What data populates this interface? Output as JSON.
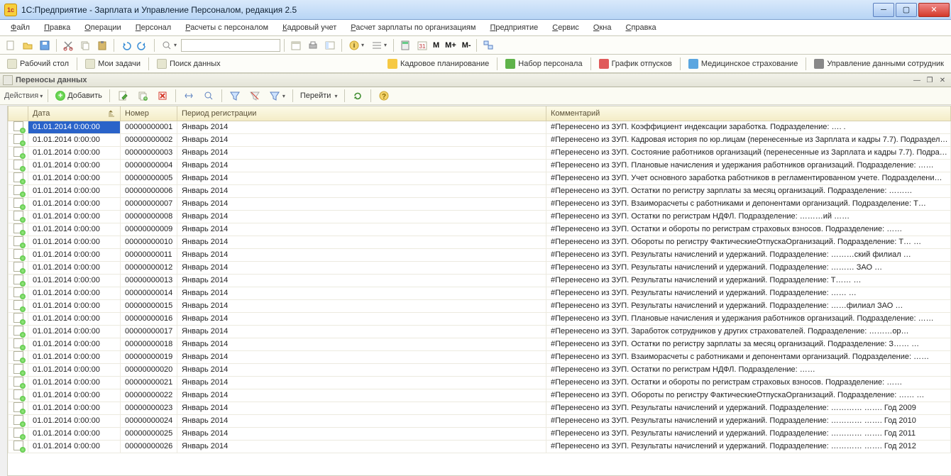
{
  "title": "1С:Предприятие - Зарплата и Управление Персоналом, редакция 2.5",
  "menus": [
    "Файл",
    "Правка",
    "Операции",
    "Персонал",
    "Расчеты с персоналом",
    "Кадровый учет",
    "Расчет зарплаты по организациям",
    "Предприятие",
    "Сервис",
    "Окна",
    "Справка"
  ],
  "toolbar_mm": {
    "m": "M",
    "m_plus": "M+",
    "m_minus": "M-"
  },
  "row2_left": [
    {
      "label": "Рабочий стол"
    },
    {
      "label": "Мои задачи"
    },
    {
      "label": "Поиск данных"
    }
  ],
  "row2_right": [
    {
      "label": "Кадровое планирование",
      "chip": "#f6c944"
    },
    {
      "label": "Набор персонала",
      "chip": "#5fb34a"
    },
    {
      "label": "График отпусков",
      "chip": "#e05a5a"
    },
    {
      "label": "Медицинское страхование",
      "chip": "#5aa6e0"
    },
    {
      "label": "Управление данными сотрудник",
      "chip": "#888"
    }
  ],
  "subwin_title": "Переносы данных",
  "actions_label": "Действия",
  "add_label": "Добавить",
  "goto_label": "Перейти",
  "columns": {
    "icon": "",
    "date": "Дата",
    "number": "Номер",
    "reg": "Период регистрации",
    "comment": "Комментарий"
  },
  "rows": [
    {
      "date": "01.01.2014 0:00:00",
      "number": "00000000001",
      "reg": "Январь 2014",
      "comment": "#Перенесено из ЗУП. Коэффициент индексации заработка. Подразделение: ….                                   .           "
    },
    {
      "date": "01.01.2014 0:00:00",
      "number": "00000000002",
      "reg": "Январь 2014",
      "comment": "#Перенесено из ЗУП. Кадровая история по юр.лицам (перенесенные из Зарплата и кадры 7.7). Подраздел…"
    },
    {
      "date": "01.01.2014 0:00:00",
      "number": "00000000003",
      "reg": "Январь 2014",
      "comment": "#Перенесено из ЗУП. Состояние работников организаций (перенесенные из Зарплата и кадры 7.7). Подра…"
    },
    {
      "date": "01.01.2014 0:00:00",
      "number": "00000000004",
      "reg": "Январь 2014",
      "comment": "#Перенесено из ЗУП. Плановые начисления и удержания работников организаций. Подразделение: ……"
    },
    {
      "date": "01.01.2014 0:00:00",
      "number": "00000000005",
      "reg": "Январь 2014",
      "comment": "#Перенесено из ЗУП. Учет основного заработка работников в регламентированном учете. Подразделени…"
    },
    {
      "date": "01.01.2014 0:00:00",
      "number": "00000000006",
      "reg": "Январь 2014",
      "comment": "#Перенесено из ЗУП. Остатки по регистру зарплаты за месяц организаций. Подразделение: ………"
    },
    {
      "date": "01.01.2014 0:00:00",
      "number": "00000000007",
      "reg": "Январь 2014",
      "comment": "#Перенесено из ЗУП. Взаиморасчеты с работниками и депонентами организаций. Подразделение: Т…"
    },
    {
      "date": "01.01.2014 0:00:00",
      "number": "00000000008",
      "reg": "Январь 2014",
      "comment": "#Перенесено из ЗУП. Остатки по регистрам НДФЛ. Подразделение: ………ий                ……"
    },
    {
      "date": "01.01.2014 0:00:00",
      "number": "00000000009",
      "reg": "Январь 2014",
      "comment": "#Перенесено из ЗУП. Остатки и обороты по регистрам страховых взносов. Подразделение: ……"
    },
    {
      "date": "01.01.2014 0:00:00",
      "number": "00000000010",
      "reg": "Январь 2014",
      "comment": "#Перенесено из ЗУП. Обороты по регистру ФактическиеОтпускаОрганизаций. Подразделение: Т…    …"
    },
    {
      "date": "01.01.2014 0:00:00",
      "number": "00000000011",
      "reg": "Январь 2014",
      "comment": "#Перенесено из ЗУП. Результаты начислений и удержаний. Подразделение: ………ский филиал       …"
    },
    {
      "date": "01.01.2014 0:00:00",
      "number": "00000000012",
      "reg": "Январь 2014",
      "comment": "#Перенесено из ЗУП. Результаты начислений и удержаний. Подразделение: ………                 ЗАО …"
    },
    {
      "date": "01.01.2014 0:00:00",
      "number": "00000000013",
      "reg": "Январь 2014",
      "comment": "#Перенесено из ЗУП. Результаты начислений и удержаний. Подразделение: Т……                         …"
    },
    {
      "date": "01.01.2014 0:00:00",
      "number": "00000000014",
      "reg": "Январь 2014",
      "comment": "#Перенесено из ЗУП. Результаты начислений и удержаний. Подразделение: ……                           …"
    },
    {
      "date": "01.01.2014 0:00:00",
      "number": "00000000015",
      "reg": "Январь 2014",
      "comment": "#Перенесено из ЗУП. Результаты начислений и удержаний. Подразделение: ……филиал ЗАО …"
    },
    {
      "date": "01.01.2014 0:00:00",
      "number": "00000000016",
      "reg": "Январь 2014",
      "comment": "#Перенесено из ЗУП. Плановые начисления и удержания работников организаций. Подразделение: ……"
    },
    {
      "date": "01.01.2014 0:00:00",
      "number": "00000000017",
      "reg": "Январь 2014",
      "comment": "#Перенесено из ЗУП. Заработок сотрудников у других страхователей. Подразделение: ………ор…"
    },
    {
      "date": "01.01.2014 0:00:00",
      "number": "00000000018",
      "reg": "Январь 2014",
      "comment": "#Перенесено из ЗУП. Остатки по регистру зарплаты за месяц организаций. Подразделение: З……        …"
    },
    {
      "date": "01.01.2014 0:00:00",
      "number": "00000000019",
      "reg": "Январь 2014",
      "comment": "#Перенесено из ЗУП. Взаиморасчеты с работниками и депонентами организаций. Подразделение: ……"
    },
    {
      "date": "01.01.2014 0:00:00",
      "number": "00000000020",
      "reg": "Январь 2014",
      "comment": "#Перенесено из ЗУП. Остатки по регистрам НДФЛ. Подразделение: ……                                       "
    },
    {
      "date": "01.01.2014 0:00:00",
      "number": "00000000021",
      "reg": "Январь 2014",
      "comment": "#Перенесено из ЗУП. Остатки и обороты по регистрам страховых взносов. Подразделение: ……             "
    },
    {
      "date": "01.01.2014 0:00:00",
      "number": "00000000022",
      "reg": "Январь 2014",
      "comment": "#Перенесено из ЗУП. Обороты по регистру ФактическиеОтпускаОрганизаций. Подразделение: ……         …"
    },
    {
      "date": "01.01.2014 0:00:00",
      "number": "00000000023",
      "reg": "Январь 2014",
      "comment": "#Перенесено из ЗУП. Результаты начислений и удержаний. Подразделение: …………         ……. Год 2009"
    },
    {
      "date": "01.01.2014 0:00:00",
      "number": "00000000024",
      "reg": "Январь 2014",
      "comment": "#Перенесено из ЗУП. Результаты начислений и удержаний. Подразделение: …………         ……. Год 2010"
    },
    {
      "date": "01.01.2014 0:00:00",
      "number": "00000000025",
      "reg": "Январь 2014",
      "comment": "#Перенесено из ЗУП. Результаты начислений и удержаний. Подразделение: …………         ……. Год 2011"
    },
    {
      "date": "01.01.2014 0:00:00",
      "number": "00000000026",
      "reg": "Январь 2014",
      "comment": "#Перенесено из ЗУП. Результаты начислений и удержаний. Подразделение: …………         ……. Год 2012"
    }
  ]
}
